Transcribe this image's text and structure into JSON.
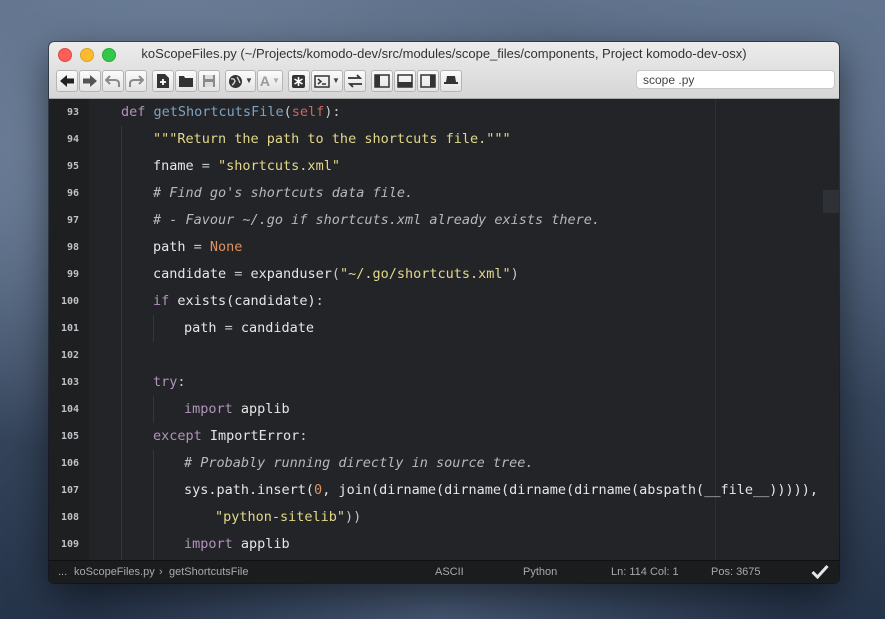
{
  "window": {
    "title": "koScopeFiles.py (~/Projects/komodo-dev/src/modules/scope_files/components, Project komodo-dev-osx)"
  },
  "toolbar": {
    "buttons": [
      "back-arrow-icon",
      "forward-arrow-icon",
      "undo-icon",
      "redo-icon",
      "new-file-icon",
      "open-folder-icon",
      "save-icon",
      "globe-icon",
      "font-icon",
      "toolbox-icon",
      "terminal-icon",
      "compare-icon",
      "left-pane-icon",
      "bottom-pane-icon",
      "right-pane-icon",
      "hat-icon"
    ],
    "scope_value": "scope .py"
  },
  "editor": {
    "lines": [
      {
        "num": "93"
      },
      {
        "num": "94"
      },
      {
        "num": "95"
      },
      {
        "num": "96"
      },
      {
        "num": "97"
      },
      {
        "num": "98"
      },
      {
        "num": "99"
      },
      {
        "num": "100"
      },
      {
        "num": "101"
      },
      {
        "num": "102"
      },
      {
        "num": "103"
      },
      {
        "num": "104"
      },
      {
        "num": "105"
      },
      {
        "num": "106"
      },
      {
        "num": "107"
      },
      {
        "num": "108"
      },
      {
        "num": "109"
      }
    ],
    "tokens": {
      "l93": [
        "def",
        "getShortcutsFile",
        "(",
        "self",
        "):"
      ],
      "l94": [
        "\"\"\"Return the path to the shortcuts file.\"\"\""
      ],
      "l95": [
        "fname",
        " = ",
        "\"shortcuts.xml\""
      ],
      "l96": [
        "# Find go's shortcuts data file."
      ],
      "l97": [
        "# - Favour ~/.go if shortcuts.xml already exists there."
      ],
      "l98": [
        "path",
        " = ",
        "None"
      ],
      "l99": [
        "candidate",
        " = ",
        "expanduser",
        "(",
        "\"~/.go/shortcuts.xml\"",
        ")"
      ],
      "l100": [
        "if",
        " exists",
        "(candidate)",
        ":"
      ],
      "l101": [
        "path",
        " = ",
        "candidate"
      ],
      "l103": [
        "try",
        ":"
      ],
      "l104": [
        "import",
        " applib"
      ],
      "l105": [
        "except",
        " ImportError",
        ":"
      ],
      "l106": [
        "# Probably running directly in source tree."
      ],
      "l107": [
        "sys.path.insert(",
        "0",
        ", join(dirname(dirname(dirname(dirname(abspath(__file__))))),"
      ],
      "l108": [
        "\"python-sitelib\"",
        "))"
      ],
      "l109": [
        "import",
        " applib"
      ]
    }
  },
  "statusbar": {
    "breadcrumb_prefix": "...",
    "file": "koScopeFiles.py",
    "separator": "›",
    "symbol": "getShortcutsFile",
    "encoding": "ASCII",
    "language": "Python",
    "position": "Ln: 114 Col: 1",
    "pos": "Pos: 3675"
  },
  "colors": {
    "editor_bg": "#222427",
    "keyword": "#b294bb",
    "function": "#81a2be",
    "string": "#e3d88a",
    "self": "#cc6666",
    "number": "#de935f"
  }
}
